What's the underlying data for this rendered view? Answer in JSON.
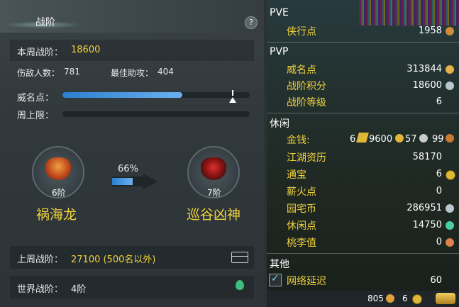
{
  "left_panel": {
    "title": "战阶",
    "help": "?",
    "week_rank_label": "本周战阶：",
    "week_rank_value": "18600",
    "kills_label": "伤敌人数：",
    "kills_value": "781",
    "best_assist_label": "最佳助攻：",
    "best_assist_value": "404",
    "prestige_label": "威名点：",
    "prestige_progress": 0.64,
    "weekly_cap_label": "周上限：",
    "weekly_cap_progress": 0,
    "current_emblem": {
      "tier": "6阶",
      "name": "祸海龙"
    },
    "next_emblem": {
      "tier": "7阶",
      "name": "巡谷凶神"
    },
    "progress_percent": "66%",
    "last_week_label": "上周战阶：",
    "last_week_value": "27100 (500名以外)",
    "world_rank_label": "世界战阶：",
    "world_rank_value": "4阶"
  },
  "right_panel": {
    "pve": {
      "header": "PVE",
      "items": [
        {
          "label": "侠行点",
          "value": "1958"
        }
      ]
    },
    "pvp": {
      "header": "PVP",
      "items": [
        {
          "label": "威名点",
          "value": "313844"
        },
        {
          "label": "战阶积分",
          "value": "18600"
        },
        {
          "label": "战阶等级",
          "value": "6"
        }
      ]
    },
    "leisure": {
      "header": "休闲",
      "items": [
        {
          "label": "金钱:",
          "value": "6 9600 57 99"
        },
        {
          "label": "江湖资历",
          "value": "58170"
        },
        {
          "label": "通宝",
          "value": "6"
        },
        {
          "label": "薪火点",
          "value": "0"
        },
        {
          "label": "园宅币",
          "value": "286951"
        },
        {
          "label": "休闲点",
          "value": "14750"
        },
        {
          "label": "桃李值",
          "value": "0"
        }
      ]
    },
    "other": {
      "header": "其他",
      "items": [
        {
          "label": "网络延迟",
          "value": "60"
        }
      ]
    },
    "money": {
      "gold": "6",
      "silver": "9600",
      "copper1": "57",
      "copper2": "99"
    }
  },
  "bottom_bar": {
    "left_value": "805",
    "mid_value": "6"
  },
  "colors": {
    "accent": "#f0d23c",
    "bar": "#4a9be6"
  }
}
